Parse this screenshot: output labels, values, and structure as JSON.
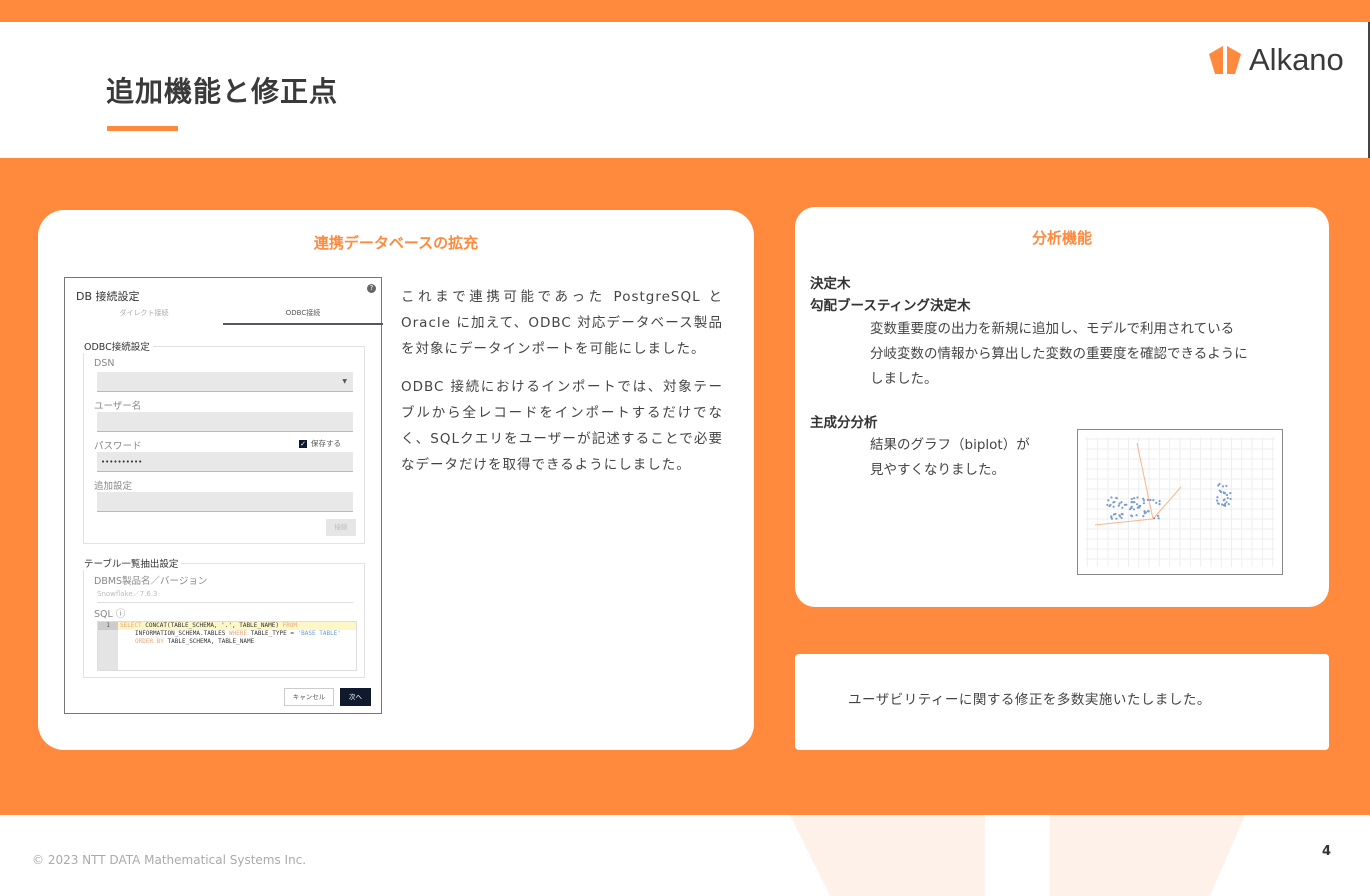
{
  "header": {
    "title": "追加機能と修正点",
    "logo_text": "Alkano"
  },
  "left_card": {
    "title": "連携データベースの拡充",
    "paragraphs": [
      "これまで連携可能であった PostgreSQL と Oracle に加えて、ODBC 対応データベース製品を対象にデータインポートを可能にしました。",
      "ODBC 接続におけるインポートでは、対象テーブルから全レコードをインポートするだけでなく、SQLクエリをユーザーが記述することで必要なデータだけを取得できるようにしました。"
    ],
    "dialog": {
      "title": "DB 接続設定",
      "tabs": [
        "ダイレクト接続",
        "ODBC接続"
      ],
      "odbc_section": "ODBC接続設定",
      "dsn_label": "DSN",
      "user_label": "ユーザー名",
      "password_label": "パスワード",
      "password_value": "••••••••••",
      "save_label": "保存する",
      "extra_label": "追加設定",
      "connect_button": "接続",
      "table_section": "テーブル一覧抽出設定",
      "dbms_label": "DBMS製品名／バージョン",
      "dbms_value": "Snowflake／7.6.3",
      "sql_label": "SQL",
      "line_no": "1",
      "sql": {
        "l1a": "SELECT",
        "l1b": " CONCAT(TABLE_SCHEMA, '.', TABLE_NAME) ",
        "l1c": "FROM",
        "l2a": "INFORMATION_SCHEMA.TABLES ",
        "l2b": "WHERE",
        "l2c": " TABLE_TYPE = ",
        "l2d": "'BASE TABLE'",
        "l3a": "ORDER BY",
        "l3b": " TABLE_SCHEMA, TABLE_NAME"
      },
      "cancel_button": "キャンセル",
      "next_button": "次へ"
    }
  },
  "right_card": {
    "title": "分析機能",
    "dt_heading": "決定木",
    "gbdt_heading": "勾配ブースティング決定木",
    "gbdt_text": [
      "変数重要度の出力を新規に追加し、モデルで利用されている",
      "分岐変数の情報から算出した変数の重要度を確認できるように",
      "しました。"
    ],
    "pca_heading": "主成分分析",
    "pca_text": [
      "結果のグラフ（biplot）が",
      "見やすくなりました。"
    ]
  },
  "bottom_card": {
    "text": "ユーザビリティーに関する修正を多数実施いたしました。"
  },
  "footer": {
    "copyright": "© 2023 NTT DATA Mathematical Systems Inc.",
    "page": "4"
  },
  "colors": {
    "accent": "#ff8a3d",
    "dark_button": "#0f1a2e"
  }
}
